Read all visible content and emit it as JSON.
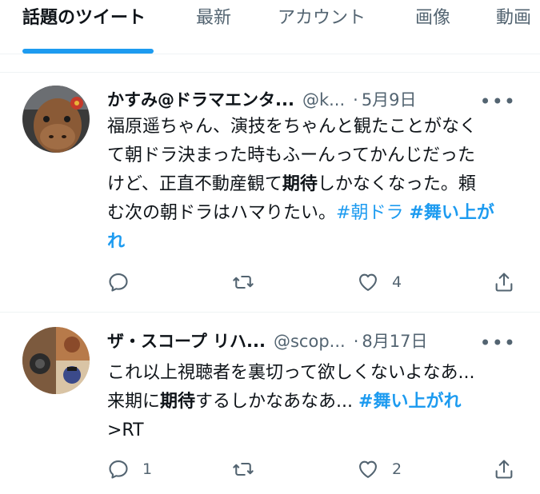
{
  "tabs": [
    {
      "label": "話題のツイート",
      "active": true
    },
    {
      "label": "最新",
      "active": false
    },
    {
      "label": "アカウント",
      "active": false
    },
    {
      "label": "画像",
      "active": false
    },
    {
      "label": "動画",
      "active": false
    }
  ],
  "accent_color": "#1d9bf0",
  "tweets": [
    {
      "name": "かすみ@ドラマエンタ...",
      "handle": "@k...",
      "dot": "·",
      "date": "5月9日",
      "more": "•••",
      "lines": [
        [
          {
            "text": "福原遥ちゃん、演技をちゃんと観たことがなく"
          }
        ],
        [
          {
            "text": "て朝ドラ決まった時もふーんってかんじだった"
          }
        ],
        [
          {
            "text": "けど、正直不動産観て"
          },
          {
            "text": "期待",
            "style": "bold"
          },
          {
            "text": "しかなくなった。頼"
          }
        ],
        [
          {
            "text": "む次の朝ドラはハマりたい。"
          },
          {
            "text": "#朝ドラ",
            "style": "hash"
          },
          {
            "text": " "
          },
          {
            "text": "#舞い上が",
            "style": "hash bold"
          }
        ],
        [
          {
            "text": "れ",
            "style": "hash bold"
          }
        ]
      ],
      "reply_count": "",
      "retweet_count": "",
      "like_count": "4"
    },
    {
      "name": "ザ・スコープ リハ...",
      "handle": "@scop...",
      "dot": "·",
      "date": "8月17日",
      "more": "•••",
      "lines": [
        [
          {
            "text": "これ以上視聴者を裏切って欲しくないよなあ..."
          }
        ],
        [
          {
            "text": "来期に"
          },
          {
            "text": "期待",
            "style": "bold"
          },
          {
            "text": "するしかなあなあ... "
          },
          {
            "text": "#舞い上がれ",
            "style": "hash bold"
          }
        ],
        [
          {
            "text": ">RT"
          }
        ]
      ],
      "reply_count": "1",
      "retweet_count": "",
      "like_count": "2"
    }
  ]
}
